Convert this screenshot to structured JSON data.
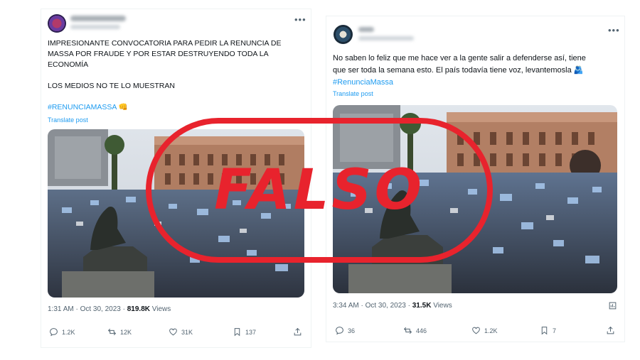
{
  "tweets": [
    {
      "text": [
        "IMPRESIONANTE CONVOCATORIA PARA PEDIR LA RENUNCIA DE",
        "MASSA POR FRAUDE Y POR ESTAR DESTRUYENDO TODA LA",
        "ECONOMÍA",
        "",
        "LOS MEDIOS NO TE LO MUESTRAN"
      ],
      "hashtag": "#RENUNCIAMASSA 👊",
      "translate": "Translate post",
      "time": "1:31 AM · Oct 30, 2023 · ",
      "views_count": "819.8K",
      "views_label": " Views",
      "actions": {
        "replies": "1.2K",
        "reposts": "12K",
        "likes": "31K",
        "bookmarks": "137"
      }
    },
    {
      "text": [
        "No saben lo feliz que me hace ver a la gente salir a defenderse así, tiene",
        "que ser toda la semana esto. El país todavía tiene voz, levantemosla 🫂"
      ],
      "hashtag": "#RenunciaMassa",
      "translate": "Translate post",
      "time": "3:34 AM · Oct 30, 2023 · ",
      "views_count": "31.5K",
      "views_label": " Views",
      "actions": {
        "replies": "36",
        "reposts": "446",
        "likes": "1.2K",
        "bookmarks": "7"
      }
    }
  ],
  "stamp": "FALSO",
  "more_icon": "•••",
  "colors": {
    "accent": "#1d9bf0",
    "stamp": "#e8232d",
    "muted": "#536471"
  }
}
